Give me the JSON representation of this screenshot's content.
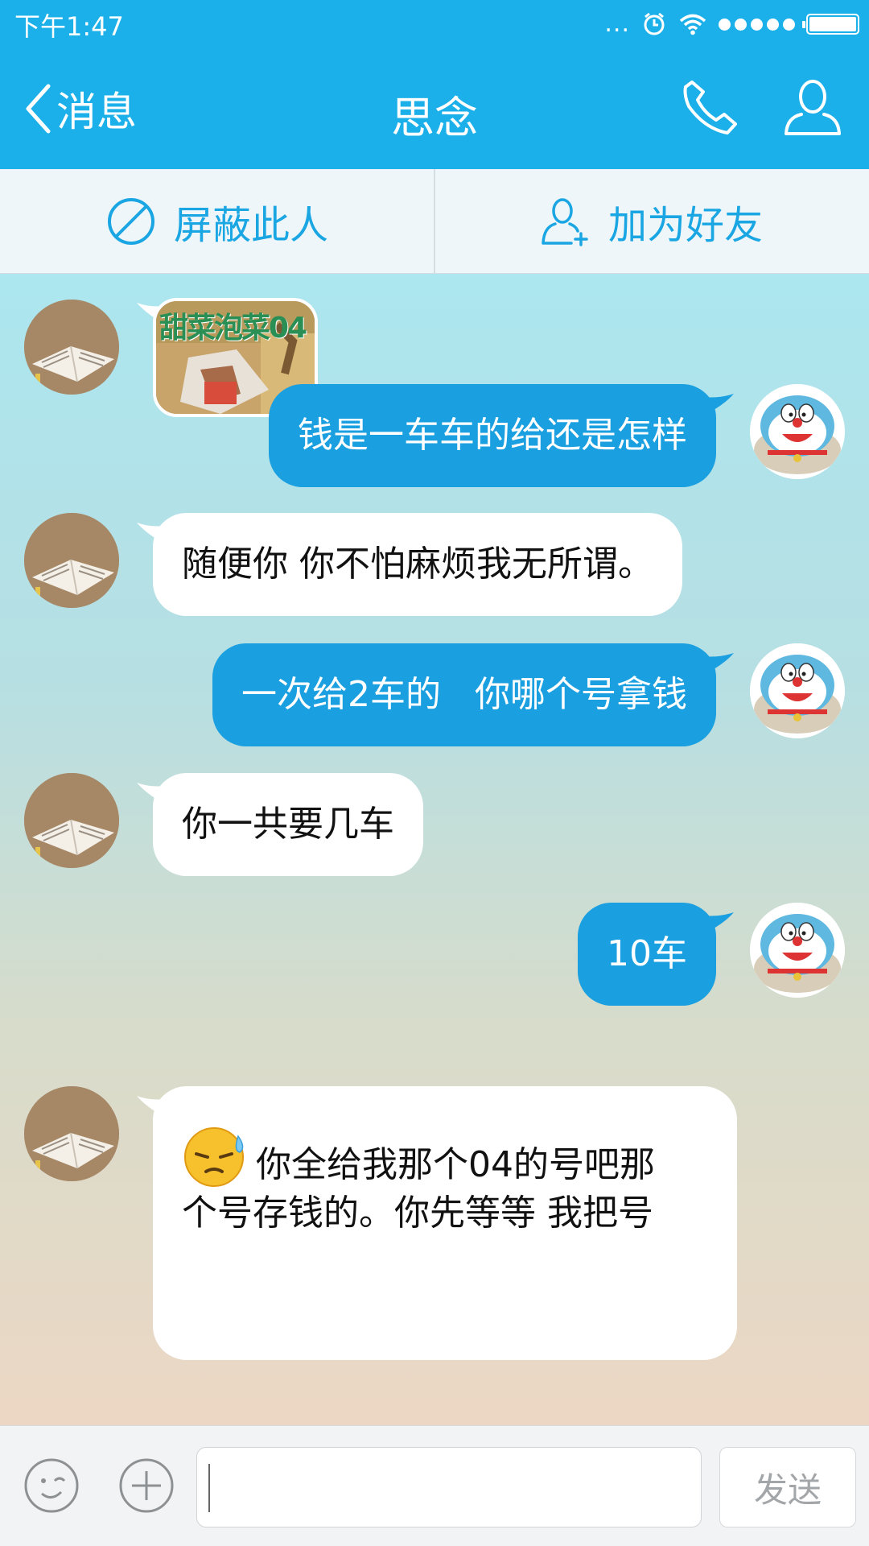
{
  "status_bar": {
    "time": "下午1:47",
    "carrier_dots": "...",
    "icons": [
      "alarm-icon",
      "wifi-icon",
      "signal-icon",
      "battery-icon"
    ]
  },
  "nav": {
    "back_label": "消息",
    "title": "思念",
    "icons": [
      "phone-icon",
      "profile-icon"
    ]
  },
  "actions": {
    "block_label": "屏蔽此人",
    "add_friend_label": "加为好友"
  },
  "messages": [
    {
      "side": "in",
      "type": "sticker",
      "sticker_text": "甜菜泡菜04"
    },
    {
      "side": "out",
      "text": "钱是一车车的给还是怎样"
    },
    {
      "side": "in",
      "text": "随便你 你不怕麻烦我无所谓。"
    },
    {
      "side": "out",
      "text": "一次给2车的   你哪个号拿钱"
    },
    {
      "side": "in",
      "text": "你一共要几车"
    },
    {
      "side": "out",
      "text": "10车"
    },
    {
      "side": "in",
      "emoji": "sweat-emoji",
      "line1": "你全给我那个04的号吧那",
      "line2": "个号存钱的。你先等等 我把号"
    }
  ],
  "input": {
    "value": "",
    "send_label": "发送",
    "icons": [
      "emoji-icon",
      "plus-icon"
    ]
  },
  "colors": {
    "brand": "#1bb0ea",
    "out_bubble": "#1a9fe0",
    "action_text": "#1aa6e3"
  }
}
